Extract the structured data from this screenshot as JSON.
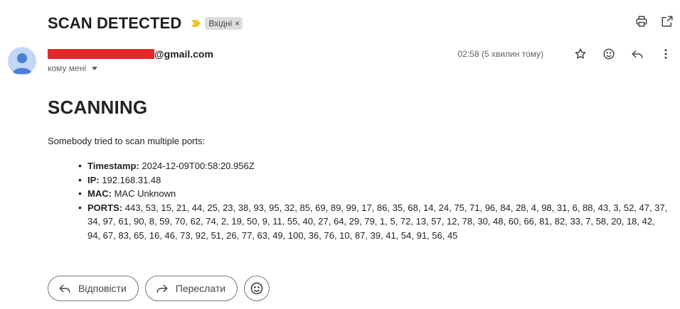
{
  "subject": "SCAN DETECTED",
  "label": {
    "text": "Вхідні",
    "remove": "×"
  },
  "sender": {
    "email_suffix": "@gmail.com"
  },
  "recipient": "кому мені",
  "time": "02:58 (5 хвилин тому)",
  "body": {
    "heading": "SCANNING",
    "intro": "Somebody tried to scan multiple ports:",
    "facts": [
      {
        "label": "Timestamp:",
        "value": "2024-12-09T00:58:20.956Z"
      },
      {
        "label": "IP:",
        "value": "192.168.31.48"
      },
      {
        "label": "MAC:",
        "value": "MAC Unknown"
      },
      {
        "label": "PORTS:",
        "value": "443, 53, 15, 21, 44, 25, 23, 38, 93, 95, 32, 85, 69, 89, 99, 17, 86, 35, 68, 14, 24, 75, 71, 96, 84, 28, 4, 98, 31, 6, 88, 43, 3, 52, 47, 37, 34, 97, 61, 90, 8, 59, 70, 62, 74, 2, 19, 50, 9, 11, 55, 40, 27, 64, 29, 79, 1, 5, 72, 13, 57, 12, 78, 30, 48, 60, 66, 81, 82, 33, 7, 58, 20, 18, 42, 94, 67, 83, 65, 16, 46, 73, 92, 51, 26, 77, 63, 49, 100, 36, 76, 10, 87, 39, 41, 54, 91, 56, 45"
      }
    ]
  },
  "actions": {
    "reply": "Відповісти",
    "forward": "Переслати"
  },
  "icons": {
    "importance": "importance-marker-icon",
    "print": "print-icon",
    "open_new_window": "open-in-new-window-icon",
    "star": "star-icon",
    "emoji": "emoji-icon",
    "reply": "reply-icon",
    "more": "more-vert-icon",
    "forward": "forward-icon"
  },
  "colors": {
    "redaction": "#e5262b",
    "importance": "#f6bf26",
    "avatar": "#c2d6f5",
    "avatar_figure": "#4b7fd4"
  }
}
